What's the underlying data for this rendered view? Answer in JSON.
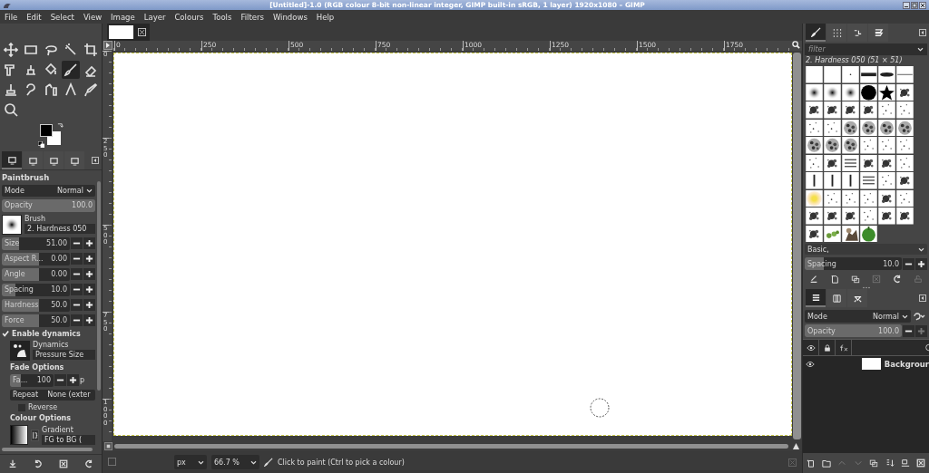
{
  "window": {
    "title": "[Untitled]-1.0 (RGB colour 8-bit non-linear integer, GIMP built-in sRGB, 1 layer) 1920x1080 – GIMP"
  },
  "menu": [
    "File",
    "Edit",
    "Select",
    "View",
    "Image",
    "Layer",
    "Colours",
    "Tools",
    "Filters",
    "Windows",
    "Help"
  ],
  "toolbox": {
    "tools": [
      {
        "selected": false
      },
      {
        "selected": false
      },
      {
        "selected": false
      },
      {
        "selected": false
      },
      {
        "selected": false
      },
      {
        "selected": false
      },
      {
        "selected": false
      },
      {
        "selected": false
      },
      {
        "selected": true
      },
      {
        "selected": false
      },
      {
        "selected": false
      },
      {
        "selected": false
      },
      {
        "selected": false
      },
      {
        "selected": false
      },
      {
        "selected": false
      },
      {
        "selected": false
      }
    ]
  },
  "dock_tabs": [
    {
      "selected": true
    },
    {
      "selected": false
    },
    {
      "selected": false
    },
    {
      "selected": false
    }
  ],
  "tool_options": {
    "title": "Paintbrush",
    "mode": {
      "label": "Mode",
      "value": "Normal"
    },
    "opacity": {
      "label": "Opacity",
      "value": "100.0",
      "level": 1
    },
    "brush": {
      "label": "Brush",
      "value": "2. Hardness 050"
    },
    "sliders": [
      {
        "label": "Size",
        "value": "51.00",
        "level": 0.25
      },
      {
        "label": "Aspect R...",
        "value": "0.00",
        "level": 0.55
      },
      {
        "label": "Angle",
        "value": "0.00",
        "level": 0.55
      },
      {
        "label": "Spacing",
        "value": "10.0",
        "level": 0.2
      },
      {
        "label": "Hardness",
        "value": "50.0",
        "level": 0.55
      },
      {
        "label": "Force",
        "value": "50.0",
        "level": 0.55
      }
    ],
    "enable_dynamics": {
      "label": "Enable dynamics",
      "checked": true
    },
    "dynamics": {
      "label": "Dynamics",
      "value": "Pressure Size"
    },
    "fade_options": {
      "title": "Fade Options",
      "length": {
        "label": "Fa...",
        "value": "100",
        "level": 0.25
      },
      "unit": "p",
      "repeat": {
        "label": "Repeat",
        "value": "None (exter"
      },
      "reverse": {
        "label": "Reverse",
        "checked": false
      }
    },
    "colour_options": {
      "title": "Colour Options",
      "gradient": {
        "label": "Gradient",
        "value": "FG to BG ("
      }
    }
  },
  "image_tabs": [
    {
      "selected": true
    }
  ],
  "rulers": {
    "horizontal": [
      "0",
      "250",
      "500",
      "750",
      "1000",
      "1250",
      "1500",
      "1750"
    ],
    "vertical": [
      "0",
      "250",
      "500",
      "750",
      "1000"
    ]
  },
  "status": {
    "unit": "px",
    "zoom": "66.7 %",
    "message": "Click to paint (Ctrl to pick a colour)"
  },
  "brushes": {
    "tabs": [
      {
        "selected": true
      },
      {
        "selected": false
      },
      {
        "selected": false
      },
      {
        "selected": false
      }
    ],
    "filter_placeholder": "filter",
    "brush_name": "2. Hardness 050 (51 × 51)",
    "rows": [
      [
        {
          "kind": "blank"
        },
        {
          "kind": "blank"
        },
        {
          "kind": "dot"
        },
        {
          "kind": "bar"
        },
        {
          "kind": "ellipse"
        },
        {
          "kind": "line"
        }
      ],
      [
        {
          "kind": "soft"
        },
        {
          "kind": "soft"
        },
        {
          "kind": "soft"
        },
        {
          "kind": "hard"
        },
        {
          "kind": "star"
        },
        {
          "kind": "splatter"
        }
      ],
      [
        {
          "kind": "splatter"
        },
        {
          "kind": "splatter"
        },
        {
          "kind": "splatter"
        },
        {
          "kind": "splatter"
        },
        {
          "kind": "speckle"
        },
        {
          "kind": "speckle"
        }
      ],
      [
        {
          "kind": "speckle"
        },
        {
          "kind": "speckle"
        },
        {
          "kind": "texture"
        },
        {
          "kind": "texture"
        },
        {
          "kind": "texture"
        },
        {
          "kind": "texture"
        }
      ],
      [
        {
          "kind": "texture"
        },
        {
          "kind": "texture"
        },
        {
          "kind": "texture"
        },
        {
          "kind": "speckle"
        },
        {
          "kind": "speckle"
        },
        {
          "kind": "speckle"
        }
      ],
      [
        {
          "kind": "speckle"
        },
        {
          "kind": "splatter"
        },
        {
          "kind": "streaks"
        },
        {
          "kind": "splatter"
        },
        {
          "kind": "splatter"
        },
        {
          "kind": "speckle"
        }
      ],
      [
        {
          "kind": "streak"
        },
        {
          "kind": "streak"
        },
        {
          "kind": "streak"
        },
        {
          "kind": "streaks"
        },
        {
          "kind": "speckle"
        },
        {
          "kind": "splatter"
        }
      ],
      [
        {
          "kind": "glow"
        },
        {
          "kind": "speckle"
        },
        {
          "kind": "speckle"
        },
        {
          "kind": "speckle"
        },
        {
          "kind": "splatter"
        },
        {
          "kind": "speckle"
        }
      ],
      [
        {
          "kind": "splatter"
        },
        {
          "kind": "splatter"
        },
        {
          "kind": "splatter"
        },
        {
          "kind": "speckle"
        },
        {
          "kind": "splatter"
        },
        {
          "kind": "splatter"
        }
      ],
      [
        {
          "kind": "splatter"
        },
        {
          "kind": "leaf"
        },
        {
          "kind": "figure"
        },
        {
          "kind": "pepper"
        }
      ]
    ],
    "preset": "Basic,",
    "spacing": {
      "label": "Spacing",
      "value": "10.0",
      "level": 0.2
    }
  },
  "layers": {
    "tabs": [
      {
        "selected": true
      },
      {
        "selected": false
      },
      {
        "selected": false
      }
    ],
    "mode": {
      "label": "Mode",
      "value": "Normal"
    },
    "opacity": {
      "label": "Opacity",
      "value": "100.0",
      "level": 1
    },
    "items": [
      {
        "name": "Backgrour",
        "visible": true
      }
    ]
  }
}
